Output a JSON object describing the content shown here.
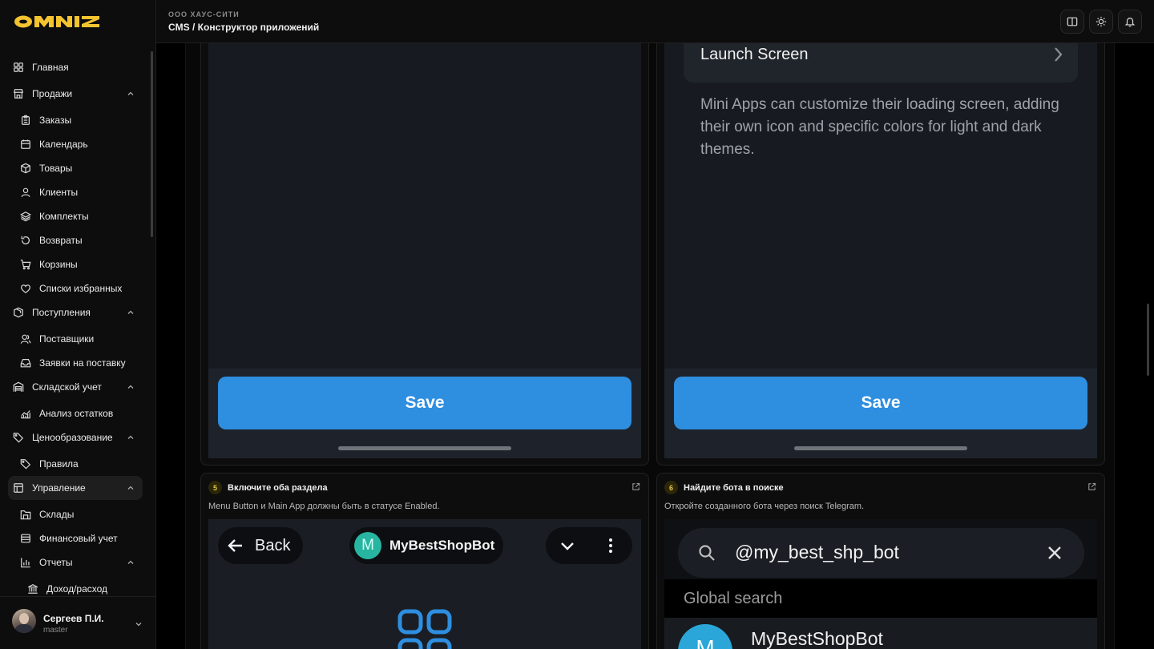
{
  "brand": {
    "logo_text": "OMNIZ"
  },
  "header": {
    "org": "ООО ХАУС-СИТИ",
    "breadcrumb": "CMS / Конструктор приложений",
    "buttons": [
      "book-icon",
      "sun-icon",
      "bell-icon"
    ]
  },
  "sidebar": {
    "items": [
      {
        "label": "Главная",
        "icon": "grid-icon",
        "level": 0
      },
      {
        "label": "Продажи",
        "icon": "store-icon",
        "level": 0,
        "expanded": true
      },
      {
        "label": "Заказы",
        "icon": "clipboard-icon",
        "level": 1
      },
      {
        "label": "Календарь",
        "icon": "calendar-icon",
        "level": 1
      },
      {
        "label": "Товары",
        "icon": "box-icon",
        "level": 1
      },
      {
        "label": "Клиенты",
        "icon": "user-icon",
        "level": 1
      },
      {
        "label": "Комплекты",
        "icon": "layers-icon",
        "level": 1
      },
      {
        "label": "Возвраты",
        "icon": "rotate-ccw-icon",
        "level": 1
      },
      {
        "label": "Корзины",
        "icon": "cart-icon",
        "level": 1
      },
      {
        "label": "Списки избранных",
        "icon": "heart-icon",
        "level": 1
      },
      {
        "label": "Поступления",
        "icon": "package-icon",
        "level": 0,
        "expanded": true
      },
      {
        "label": "Поставщики",
        "icon": "users-icon",
        "level": 1
      },
      {
        "label": "Заявки на поставку",
        "icon": "inbox-icon",
        "level": 1
      },
      {
        "label": "Складской учет",
        "icon": "warehouse-icon",
        "level": 0,
        "expanded": true
      },
      {
        "label": "Анализ остатков",
        "icon": "chart-line-icon",
        "level": 1
      },
      {
        "label": "Ценообразование",
        "icon": "tags-icon",
        "level": 0,
        "expanded": true
      },
      {
        "label": "Правила",
        "icon": "tag-icon",
        "level": 1
      },
      {
        "label": "Управление",
        "icon": "layout-icon",
        "level": 0,
        "expanded": true,
        "active": true
      },
      {
        "label": "Склады",
        "icon": "warehouse-sm-icon",
        "level": 1
      },
      {
        "label": "Финансовый учет",
        "icon": "wallet-icon",
        "level": 1
      },
      {
        "label": "Отчеты",
        "icon": "bar-chart-icon",
        "level": 1,
        "expanded": true
      },
      {
        "label": "Доход/расход",
        "icon": "bank-icon",
        "level": 2
      }
    ]
  },
  "user": {
    "name": "Сергеев П.И.",
    "role": "master"
  },
  "cards": {
    "left_top": {
      "button_label": "Save"
    },
    "right_top": {
      "row_label": "Launch Screen",
      "description": "Mini Apps can customize their loading screen, adding their own icon and specific colors for light and dark themes.",
      "button_label": "Save"
    },
    "step5": {
      "number": "5",
      "title": "Включите оба раздела",
      "description": "Menu Button и Main App должны быть в статусе Enabled.",
      "back_label": "Back",
      "bot_initial": "M",
      "bot_name": "MyBestShopBot"
    },
    "step6": {
      "number": "6",
      "title": "Найдите бота в поиске",
      "description": "Откройте созданного бота через поиск Telegram.",
      "search_query": "@my_best_shp_bot",
      "section_label": "Global search",
      "result_initial": "M",
      "result_name": "MyBestShopBot"
    }
  },
  "colors": {
    "accent_blue": "#2e8ee0",
    "step_badge": "#e2c544",
    "bot_badge": "#27b5a1",
    "result_avatar": "#2aa7d8"
  }
}
